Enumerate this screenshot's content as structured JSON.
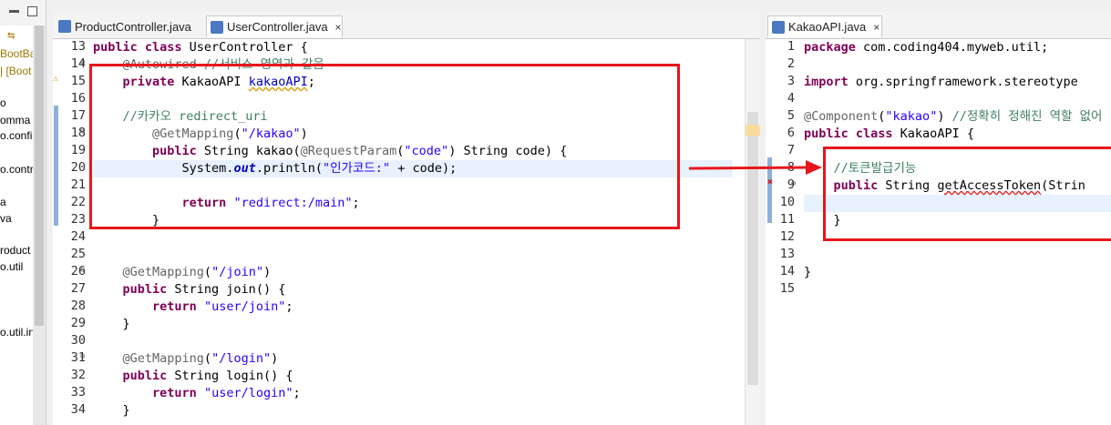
{
  "explorer": {
    "items": [
      "BootBa",
      "| [Boot",
      "o",
      "omma",
      "o.confi",
      "o.contr",
      "a",
      "va",
      "roduct",
      "o.util",
      "o.util.in"
    ]
  },
  "left_editor": {
    "tabs": [
      {
        "label": "ProductController.java",
        "active": false
      },
      {
        "label": "UserController.java",
        "active": true,
        "close": "×"
      }
    ],
    "line_numbers": [
      "13",
      "14",
      "15",
      "16",
      "17",
      "18",
      "19",
      "20",
      "21",
      "22",
      "23",
      "24",
      "25",
      "26",
      "27",
      "28",
      "29",
      "30",
      "31",
      "32",
      "33",
      "34"
    ],
    "code": {
      "l13_a": "public class",
      "l13_b": " UserController {",
      "l14_a": "    @Autowired",
      "l14_b": " //서비스 영역과 같음",
      "l15_a": "    private",
      "l15_b": " KakaoAPI ",
      "l15_c": "kakaoAPI",
      "l15_d": ";",
      "l17": "    //카카오 redirect_uri",
      "l18_a": "        @GetMapping",
      "l18_b": "(",
      "l18_c": "\"/kakao\"",
      "l18_d": ")",
      "l19_a": "        public",
      "l19_b": " String kakao(",
      "l19_c": "@RequestParam",
      "l19_d": "(",
      "l19_e": "\"code\"",
      "l19_f": ") String code) {",
      "l20_a": "            System.",
      "l20_b": "out",
      "l20_c": ".println(",
      "l20_d": "\"인가코드:\"",
      "l20_e": " + code);",
      "l22_a": "            return",
      "l22_b": " ",
      "l22_c": "\"redirect:/main\"",
      "l22_d": ";",
      "l23": "        }",
      "l26_a": "    @GetMapping",
      "l26_b": "(",
      "l26_c": "\"/join\"",
      "l26_d": ")",
      "l27_a": "    public",
      "l27_b": " String join() {",
      "l28_a": "        return",
      "l28_b": " ",
      "l28_c": "\"user/join\"",
      "l28_d": ";",
      "l29": "    }",
      "l31_a": "    @GetMapping",
      "l31_b": "(",
      "l31_c": "\"/login\"",
      "l31_d": ")",
      "l32_a": "    public",
      "l32_b": " String login() {",
      "l33_a": "        return",
      "l33_b": " ",
      "l33_c": "\"user/login\"",
      "l33_d": ";",
      "l34": "    }"
    }
  },
  "right_editor": {
    "tabs": [
      {
        "label": "KakaoAPI.java",
        "active": true,
        "close": "×"
      }
    ],
    "line_numbers": [
      "1",
      "2",
      "3",
      "4",
      "5",
      "6",
      "7",
      "8",
      "9",
      "10",
      "11",
      "12",
      "13",
      "14",
      "15"
    ],
    "code": {
      "l1_a": "package",
      "l1_b": " com.coding404.myweb.util;",
      "l3_a": "import",
      "l3_b": " org.springframework.stereotype",
      "l5_a": "@Component",
      "l5_b": "(",
      "l5_c": "\"kakao\"",
      "l5_d": ") ",
      "l5_e": "//정확히 정해진 역할 없어",
      "l6_a": "public class",
      "l6_b": " KakaoAPI {",
      "l8": "    //토큰발급기능",
      "l9_a": "    public",
      "l9_b": " String ",
      "l9_c": "getAccessToken",
      "l9_d": "(Strin",
      "l11": "    }",
      "l14": "}"
    }
  },
  "colors": {
    "annotation_box": "#e8161b",
    "keyword": "#7f0055",
    "string": "#2a00ff",
    "comment": "#3f7f5f"
  }
}
